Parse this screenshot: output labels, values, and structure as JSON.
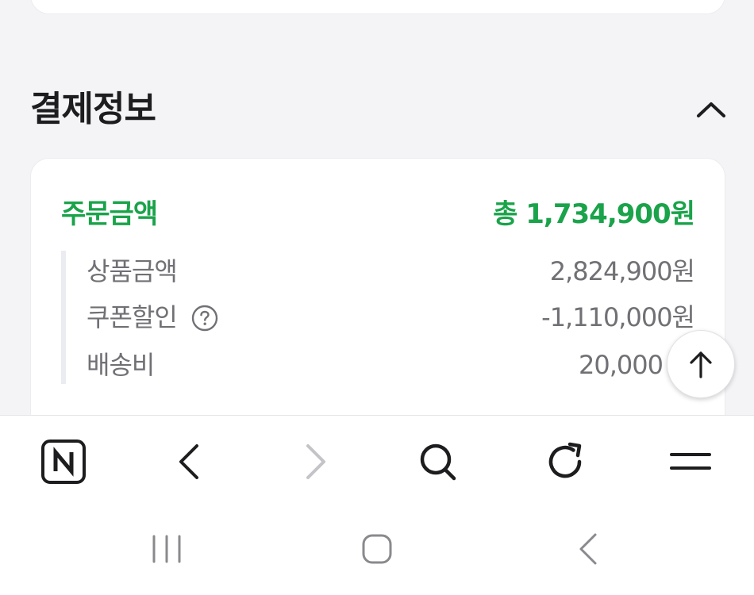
{
  "payment": {
    "title": "결제정보",
    "order_total_label": "주문금액",
    "order_total_value": "총 1,734,900원",
    "items": [
      {
        "label": "상품금액",
        "value": "2,824,900원"
      },
      {
        "label": "쿠폰할인",
        "value": "-1,110,000원"
      },
      {
        "label": "배송비",
        "value": "20,000"
      }
    ]
  },
  "colors": {
    "accent": "#1aa34a",
    "background": "#f4f4f6"
  },
  "icons": {
    "collapse": "chevron-up-icon",
    "help": "question-circle-icon",
    "scroll_top": "arrow-up-icon",
    "browser_home": "naver-n-icon",
    "back": "chevron-left-icon",
    "forward": "chevron-right-icon",
    "search": "search-icon",
    "reload": "reload-icon",
    "menu": "menu-icon",
    "recents": "recent-apps-icon",
    "home": "home-icon",
    "sys_back": "system-back-icon"
  }
}
